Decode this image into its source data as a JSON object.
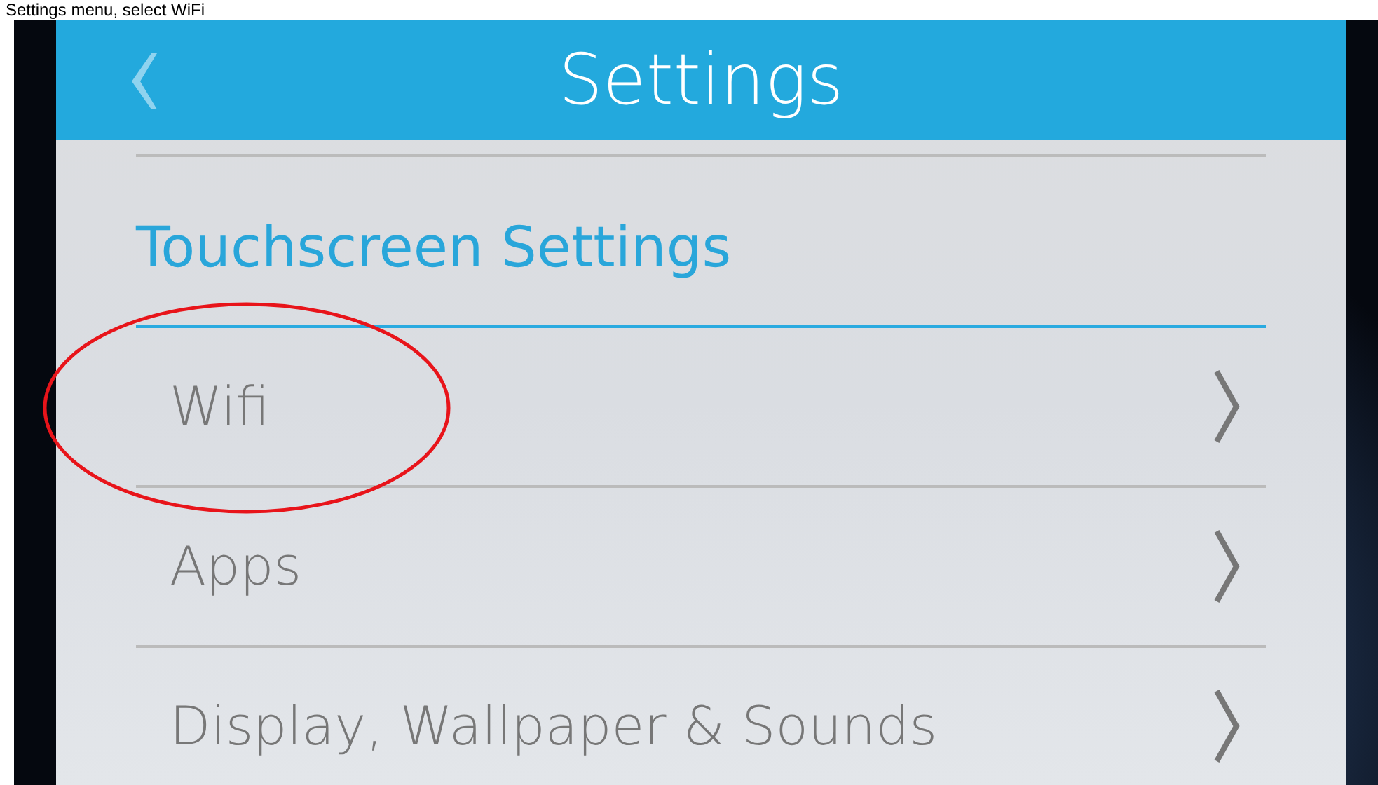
{
  "caption": "Settings menu, select WiFi",
  "dialog": {
    "title": "Settings",
    "section": "Touchscreen Settings",
    "items": [
      {
        "label": "Wifi",
        "circled": true
      },
      {
        "label": "Apps",
        "circled": false
      },
      {
        "label": "Display, Wallpaper & Sounds",
        "circled": false
      }
    ]
  }
}
